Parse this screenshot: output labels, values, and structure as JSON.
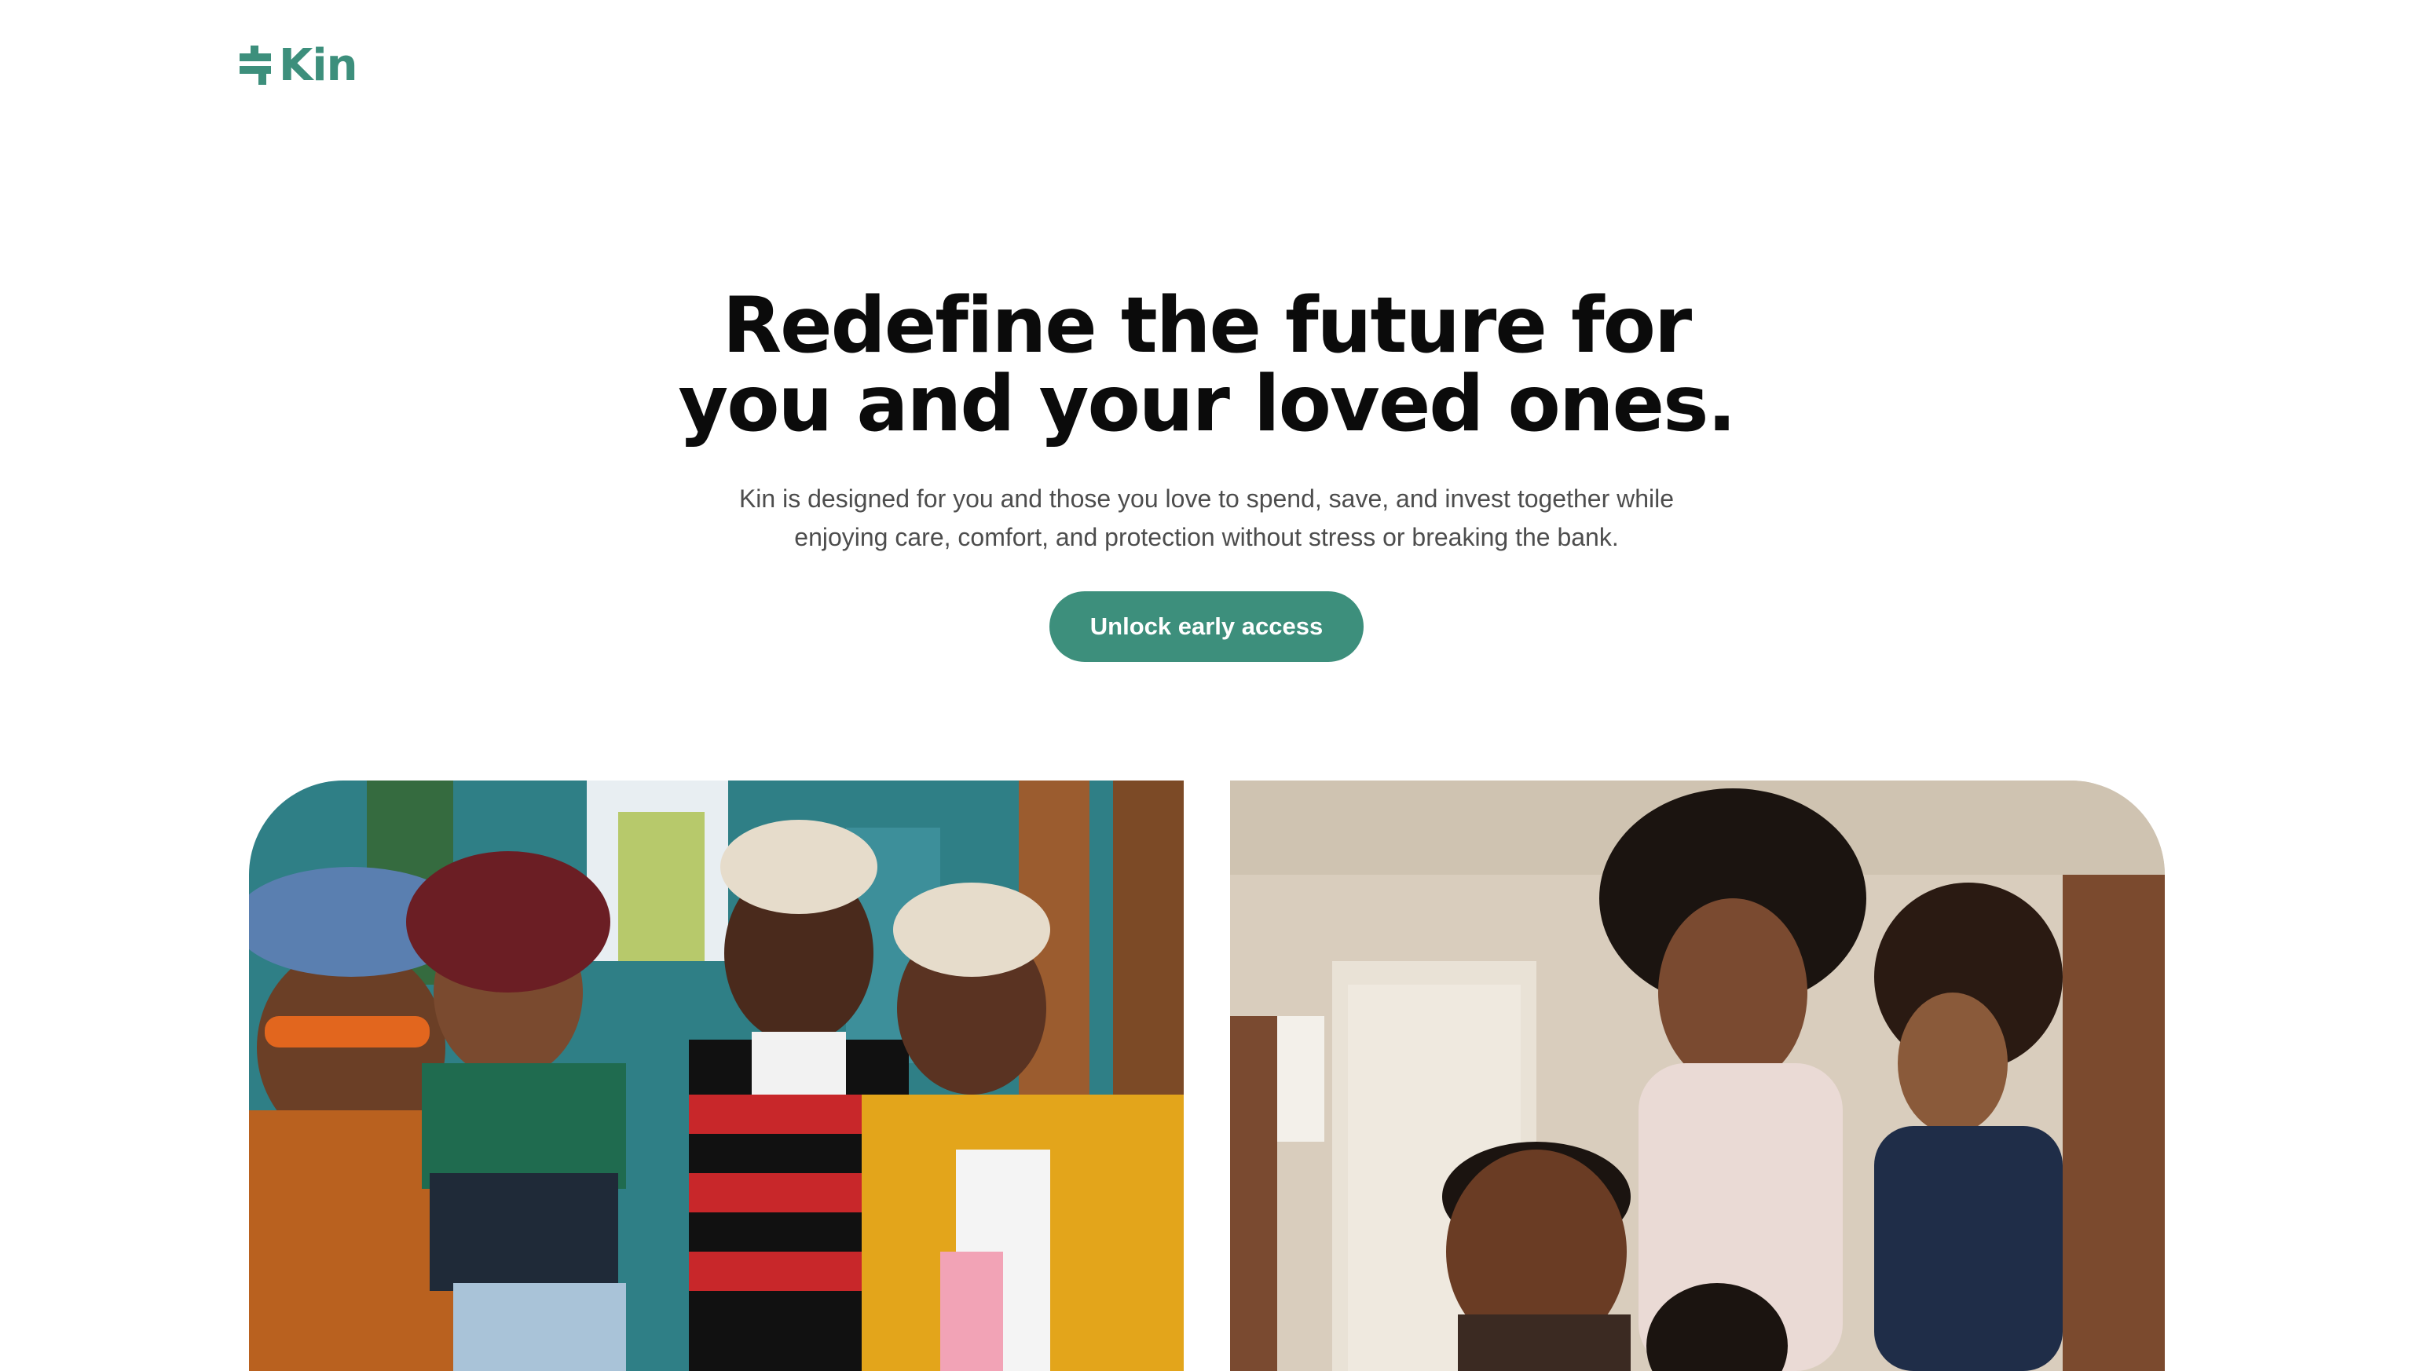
{
  "brand": {
    "name": "Kin",
    "logo_icon": "kin-cross-mark-icon",
    "accent_color": "#3d8f7c"
  },
  "hero": {
    "headline": "Redefine the future for you and your loved ones.",
    "subtitle": "Kin is designed for you and those you love to spend, save, and invest together while enjoying care, comfort, and protection without stress or breaking the bank.",
    "cta_label": "Unlock early access"
  },
  "images": [
    {
      "name": "friends-group-photo"
    },
    {
      "name": "family-selfie-photo"
    }
  ]
}
